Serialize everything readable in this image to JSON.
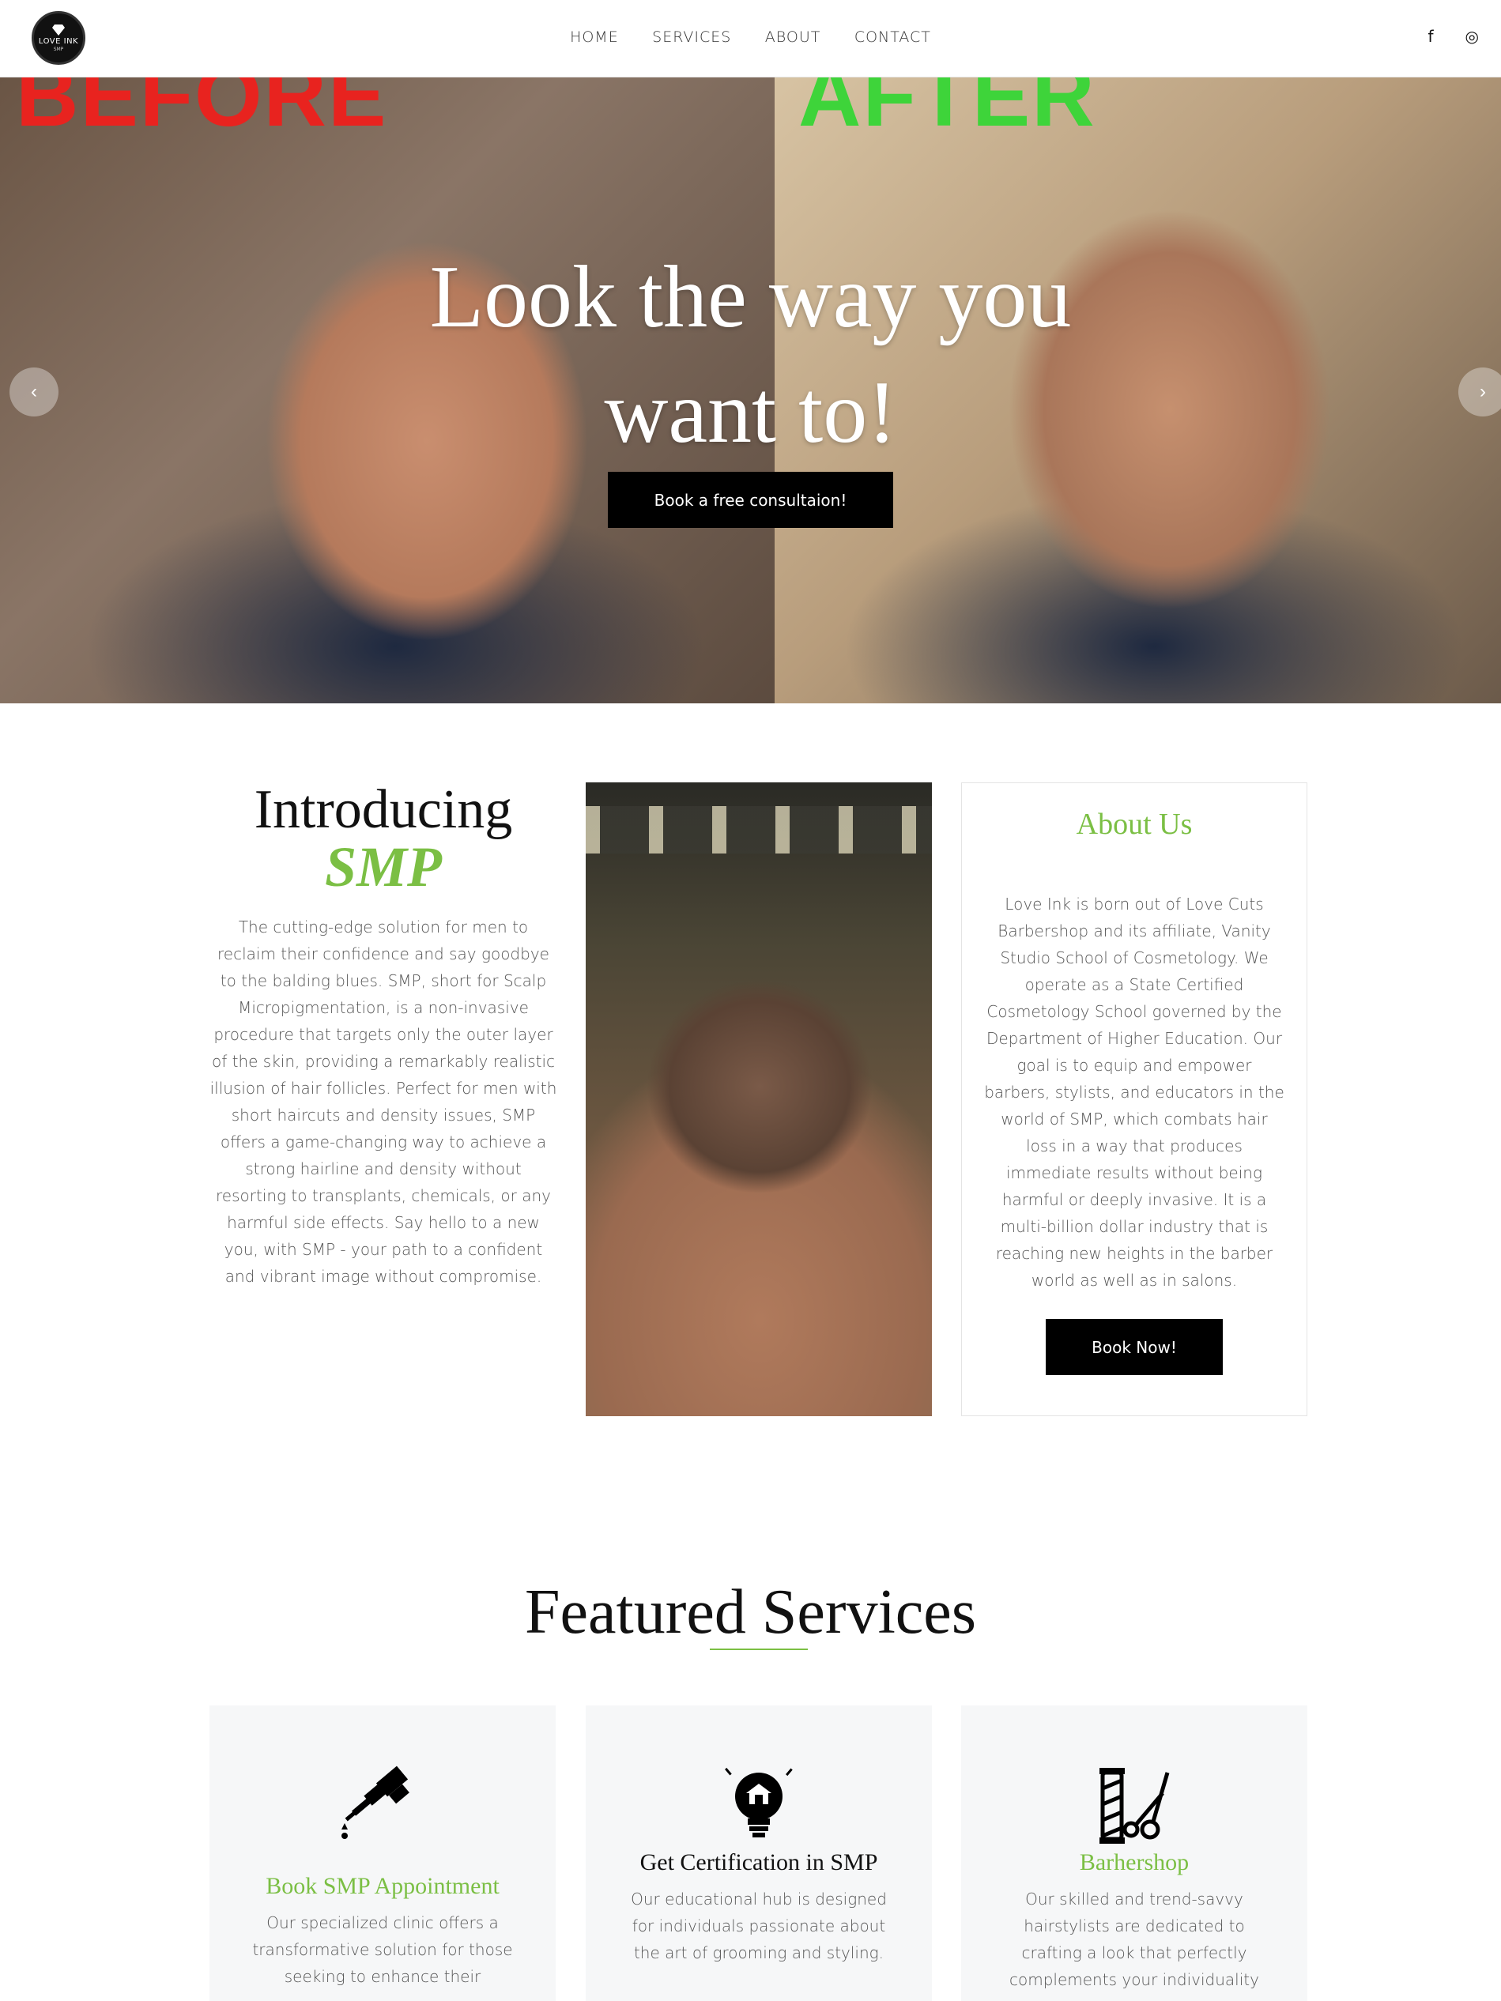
{
  "header": {
    "logo": {
      "text": "LOVE INK",
      "sub": "SMP"
    },
    "nav": [
      "HOME",
      "SERVICES",
      "ABOUT",
      "CONTACT"
    ],
    "social": {
      "facebook": "f",
      "instagram": "◎"
    }
  },
  "hero": {
    "before_label": "BEFORE",
    "after_label": "AFTER",
    "title_line1": "Look the way you",
    "title_line2": "want to!",
    "cta": "Book a free consultaion!",
    "prev": "‹",
    "next": "›"
  },
  "intro": {
    "heading": "Introducing",
    "subheading": "SMP",
    "body": "The cutting-edge solution for men to reclaim their confidence and say goodbye to the balding blues. SMP, short for Scalp Micropigmentation, is a non-invasive procedure that targets only the outer layer of the skin, providing a remarkably realistic illusion of hair follicles. Perfect for men with short haircuts and density issues, SMP offers a game-changing way to achieve a strong hairline and density without resorting to transplants, chemicals, or any harmful side effects. Say hello to a new you, with SMP - your path to a confident and vibrant image without compromise."
  },
  "about": {
    "heading": "About Us",
    "body": "Love Ink is born out of Love Cuts Barbershop and its affiliate, Vanity Studio School of Cosmetology. We operate as a State Certified Cosmetology School governed by the Department of Higher Education. Our goal is to equip and empower barbers, stylists, and educators in the world of SMP, which combats hair loss in a way that produces immediate results without being harmful or deeply invasive. It is a multi-billion dollar industry that is reaching new heights in the barber world as well as in salons.",
    "button": "Book Now!"
  },
  "featured": {
    "title": "Featured Services",
    "cards": [
      {
        "title": "Book SMP Appointment",
        "body": "Our specialized clinic offers a transformative solution for those seeking to enhance their",
        "icon": "tattoo-machine-icon"
      },
      {
        "title": "Get Certification in SMP",
        "body": "Our educational hub is designed for individuals passionate about the art of grooming and styling.",
        "icon": "lightbulb-icon"
      },
      {
        "title": "Barhershop",
        "body": "Our skilled and trend-savvy hairstylists are dedicated to crafting a look that perfectly complements your individuality",
        "icon": "barber-pole-scissors-icon"
      }
    ]
  },
  "colors": {
    "accent": "#7bbf44",
    "button": "#000000",
    "card_bg": "#f6f7f8"
  }
}
